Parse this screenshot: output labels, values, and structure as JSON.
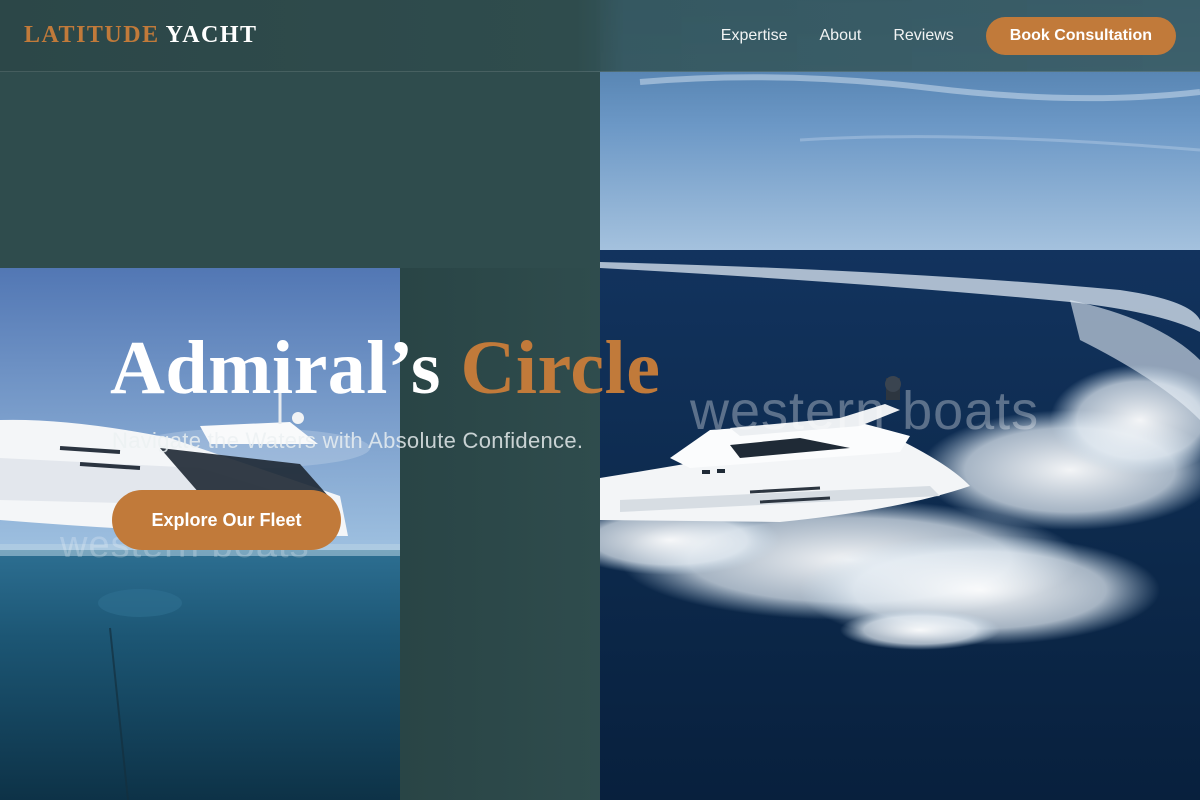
{
  "brand": {
    "accent_word": "LATITUDE",
    "main_word": "YACHT"
  },
  "nav": {
    "links": [
      "Expertise",
      "About",
      "Reviews"
    ],
    "cta_label": "Book Consultation"
  },
  "hero": {
    "title_main": "Admiral’s",
    "title_accent": "Circle",
    "subtitle": "Navigate the Waters with Absolute Confidence.",
    "button_label": "Explore Our Fleet"
  },
  "watermarks": {
    "right": "western boats",
    "left": "western boats"
  },
  "colors": {
    "background": "#2f4c4d",
    "accent": "#c17a3a",
    "text": "#ffffff"
  }
}
